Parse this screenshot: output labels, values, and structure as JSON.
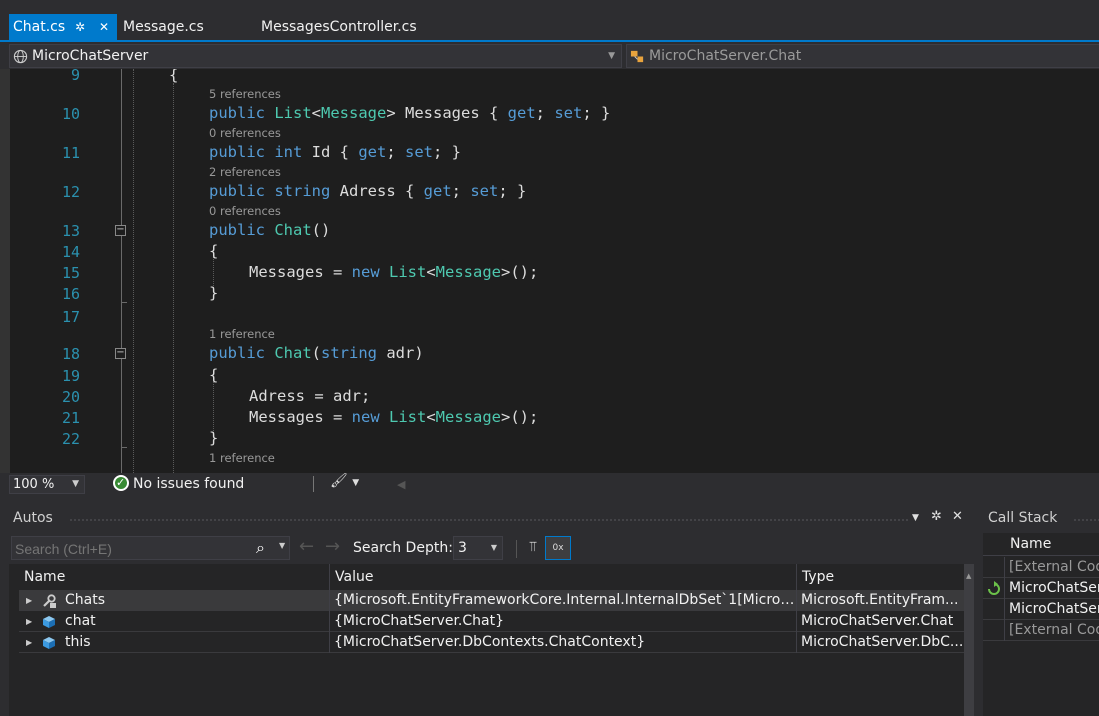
{
  "tabs": [
    {
      "label": "Chat.cs",
      "active": true
    },
    {
      "label": "Message.cs",
      "active": false
    },
    {
      "label": "MessagesController.cs",
      "active": false
    }
  ],
  "navbar": {
    "project": "MicroChatServer",
    "type": "MicroChatServer.Chat"
  },
  "editor": {
    "codelens": [
      "5 references",
      "0 references",
      "2 references",
      "0 references",
      "1 reference",
      "1 reference"
    ],
    "line_numbers": [
      "9",
      "10",
      "11",
      "12",
      "13",
      "14",
      "15",
      "16",
      "17",
      "18",
      "19",
      "20",
      "21",
      "22"
    ]
  },
  "status": {
    "zoom": "100 %",
    "issues": "No issues found"
  },
  "autos": {
    "title": "Autos",
    "search_placeholder": "Search (Ctrl+E)",
    "depth_label": "Search Depth:",
    "depth_value": "3",
    "columns": [
      "Name",
      "Value",
      "Type"
    ],
    "rows": [
      {
        "name": "Chats",
        "value": "{Microsoft.EntityFrameworkCore.Internal.InternalDbSet`1[MicroChatS...",
        "type": "Microsoft.EntityFram...",
        "icon": "wrench-property-icon"
      },
      {
        "name": "chat",
        "value": "{MicroChatServer.Chat}",
        "type": "MicroChatServer.Chat",
        "icon": "object-cube-icon"
      },
      {
        "name": "this",
        "value": "{MicroChatServer.DbContexts.ChatContext}",
        "type": "MicroChatServer.DbC...",
        "icon": "object-cube-icon"
      }
    ]
  },
  "callstack": {
    "title": "Call Stack",
    "column": "Name",
    "rows": [
      {
        "label": "[External Cod",
        "external": true
      },
      {
        "label": "MicroChatSer",
        "external": false
      },
      {
        "label": "MicroChatSer",
        "external": false
      },
      {
        "label": "[External Cod",
        "external": true
      }
    ]
  },
  "colors": {
    "accent": "#007acc",
    "keyword": "#569cd6",
    "type": "#4ec9b0",
    "line_number": "#2b91af",
    "codelens": "#999999"
  }
}
